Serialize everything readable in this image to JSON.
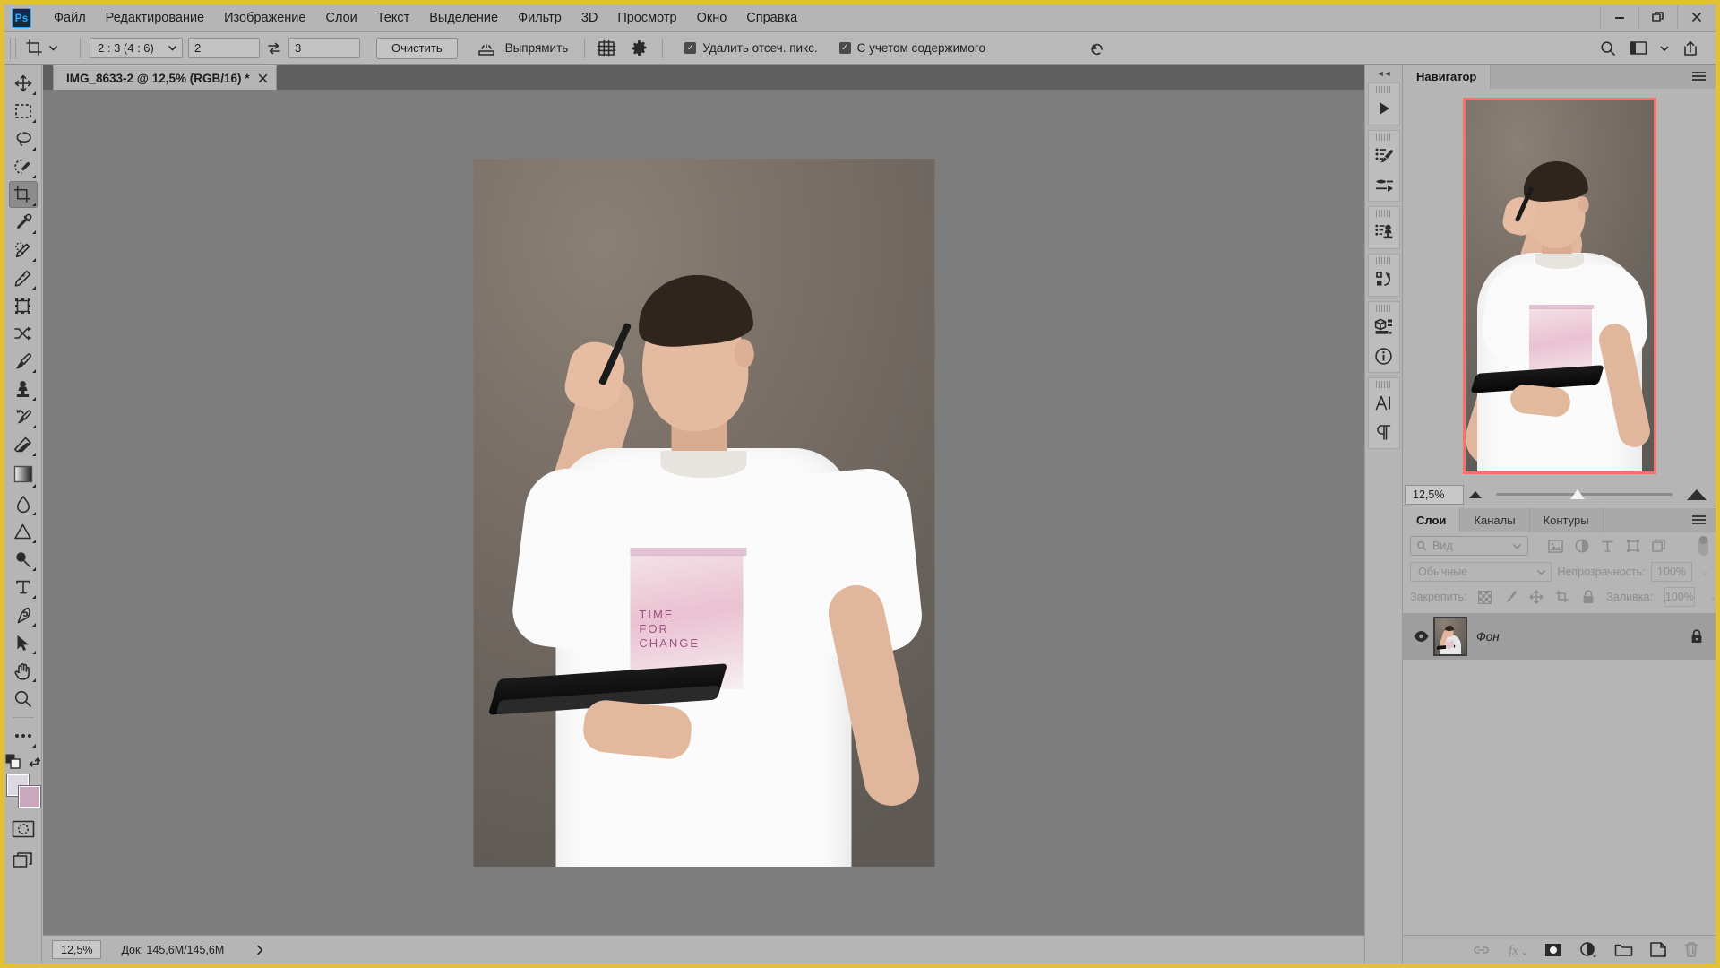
{
  "app": {
    "logo_text": "Ps",
    "accent": "#e2c234",
    "panel_bg": "#b5b5b5",
    "canvas_bg": "#7d7d7d"
  },
  "menubar": {
    "items": [
      {
        "label": "Файл"
      },
      {
        "label": "Редактирование"
      },
      {
        "label": "Изображение"
      },
      {
        "label": "Слои"
      },
      {
        "label": "Текст"
      },
      {
        "label": "Выделение"
      },
      {
        "label": "Фильтр"
      },
      {
        "label": "3D"
      },
      {
        "label": "Просмотр"
      },
      {
        "label": "Окно"
      },
      {
        "label": "Справка"
      }
    ],
    "window_controls": {
      "minimize": "minimize-icon",
      "restore": "restore-icon",
      "close": "close-icon"
    }
  },
  "options_bar": {
    "tool_icon": "crop-tool-icon",
    "ratio_select": "2 : 3 (4 : 6)",
    "width_value": "2",
    "height_value": "3",
    "swap_icon": "swap-arrows-icon",
    "clear_label": "Очистить",
    "straighten_icon": "straighten-icon",
    "straighten_label": "Выпрямить",
    "overlay_icon": "crop-overlay-grid-icon",
    "settings_icon": "gear-icon",
    "delete_cropped": {
      "label": "Удалить отсеч. пикс.",
      "checked": true
    },
    "content_aware": {
      "label": "С учетом содержимого",
      "checked": true
    },
    "reset_icon": "reset-arrow-icon",
    "right_icons": [
      "search-icon",
      "workspace-icon",
      "chevron-down-icon",
      "share-icon"
    ]
  },
  "toolbar": {
    "tools": [
      {
        "name": "move-tool",
        "icon": "move-icon",
        "has_submenu": true
      },
      {
        "name": "rectangular-marquee-tool",
        "icon": "marquee-icon",
        "has_submenu": true
      },
      {
        "name": "lasso-tool",
        "icon": "lasso-icon",
        "has_submenu": true
      },
      {
        "name": "object-selection-tool",
        "icon": "quick-selection-icon",
        "has_submenu": true
      },
      {
        "name": "crop-tool",
        "icon": "crop-icon",
        "has_submenu": true,
        "active": true
      },
      {
        "name": "eyedropper-tool",
        "icon": "eyedropper-icon",
        "has_submenu": true
      },
      {
        "name": "spot-healing-brush-tool",
        "icon": "spot-healing-icon",
        "has_submenu": true
      },
      {
        "name": "patch-tool",
        "icon": "patch-icon",
        "has_submenu": true
      },
      {
        "name": "frame-tool",
        "icon": "frame-icon",
        "has_submenu": false
      },
      {
        "name": "shuffle-tool",
        "icon": "shuffle-icon",
        "has_submenu": false
      },
      {
        "name": "brush-tool",
        "icon": "brush-icon",
        "has_submenu": true
      },
      {
        "name": "clone-stamp-tool",
        "icon": "clone-stamp-icon",
        "has_submenu": true
      },
      {
        "name": "history-brush-tool",
        "icon": "history-brush-icon",
        "has_submenu": true
      },
      {
        "name": "eraser-tool",
        "icon": "eraser-icon",
        "has_submenu": true
      },
      {
        "name": "gradient-tool",
        "icon": "gradient-icon",
        "has_submenu": true
      },
      {
        "name": "blur-tool",
        "icon": "blur-drop-icon",
        "has_submenu": true
      },
      {
        "name": "dodge-tool",
        "icon": "dodge-triangle-icon",
        "has_submenu": true
      },
      {
        "name": "burn-tool",
        "icon": "burn-icon",
        "has_submenu": true
      },
      {
        "name": "type-tool",
        "icon": "type-T-icon",
        "has_submenu": true
      },
      {
        "name": "pen-tool",
        "icon": "pen-icon",
        "has_submenu": true
      },
      {
        "name": "path-selection-tool",
        "icon": "path-arrow-icon",
        "has_submenu": true
      },
      {
        "name": "hand-tool",
        "icon": "hand-icon",
        "has_submenu": true
      },
      {
        "name": "zoom-tool",
        "icon": "magnifier-icon",
        "has_submenu": false
      },
      {
        "name": "edit-toolbar",
        "icon": "ellipsis-icon",
        "has_submenu": true
      }
    ],
    "default_colors_icon": "default-colors-icon",
    "swap_colors_icon": "swap-colors-icon",
    "foreground_color": "#dcd8e4",
    "background_color": "#c9a8bd",
    "quick_mask_icon": "quick-mask-icon",
    "screen_mode_icon": "screen-mode-icon"
  },
  "document": {
    "tab_title": "IMG_8633-2 @ 12,5% (RGB/16) *",
    "close_icon": "close-icon",
    "shirt_text_lines": [
      "TIME",
      "FOR",
      "CHANGE"
    ]
  },
  "statusbar": {
    "zoom": "12,5%",
    "doc_info": "Док: 145,6M/145,6M",
    "expand_icon": "chevron-right-icon"
  },
  "rail": {
    "collapse_icon": "collapse-double-chevron-icon",
    "groups": [
      {
        "icons": [
          "play-triangle-icon"
        ]
      },
      {
        "icons": [
          "brush-settings-icon",
          "brush-presets-icon"
        ]
      },
      {
        "icons": [
          "clone-source-icon"
        ]
      },
      {
        "icons": [
          "history-icon"
        ]
      },
      {
        "icons": [
          "3d-icon",
          "info-icon"
        ]
      },
      {
        "icons": [
          "character-icon",
          "paragraph-icon"
        ]
      }
    ]
  },
  "navigator": {
    "tabs": [
      {
        "label": "Навигатор",
        "active": true
      }
    ],
    "menu_icon": "panel-menu-icon",
    "zoom_value": "12,5%",
    "zoom_out_icon": "small-mountain-icon",
    "zoom_in_icon": "large-mountain-icon",
    "view_box_color": "#f9706b"
  },
  "layers_panel": {
    "tabs": [
      {
        "label": "Слои",
        "active": true
      },
      {
        "label": "Каналы",
        "active": false
      },
      {
        "label": "Контуры",
        "active": false
      }
    ],
    "menu_icon": "panel-menu-icon",
    "filter": {
      "search_icon": "search-icon",
      "kind_label": "Вид",
      "chevron_icon": "chevron-down-icon",
      "filter_icons": [
        "pixel-layers-icon",
        "adjustment-layers-icon",
        "type-layers-icon",
        "shape-layers-icon",
        "smart-object-icon"
      ],
      "toggle_icon": "filter-toggle-icon"
    },
    "blend_mode": "Обычные",
    "opacity_label": "Непрозрачность:",
    "opacity_value": "100%",
    "lock_label": "Закрепить:",
    "lock_icons": [
      "lock-transparent-pixels-icon",
      "lock-image-pixels-icon",
      "lock-position-icon",
      "lock-artboard-icon",
      "lock-all-icon"
    ],
    "fill_label": "Заливка:",
    "fill_value": "100%",
    "layers": [
      {
        "name": "Фон",
        "visible": true,
        "locked": true,
        "eye_icon": "eye-icon",
        "lock_icon": "lock-icon",
        "thumb": "layer-thumbnail"
      }
    ],
    "footer_icons": [
      "link-layers-icon",
      "layer-styles-fx-icon",
      "add-layer-mask-icon",
      "new-adjustment-layer-icon",
      "new-group-icon",
      "new-layer-icon",
      "delete-layer-icon"
    ]
  }
}
